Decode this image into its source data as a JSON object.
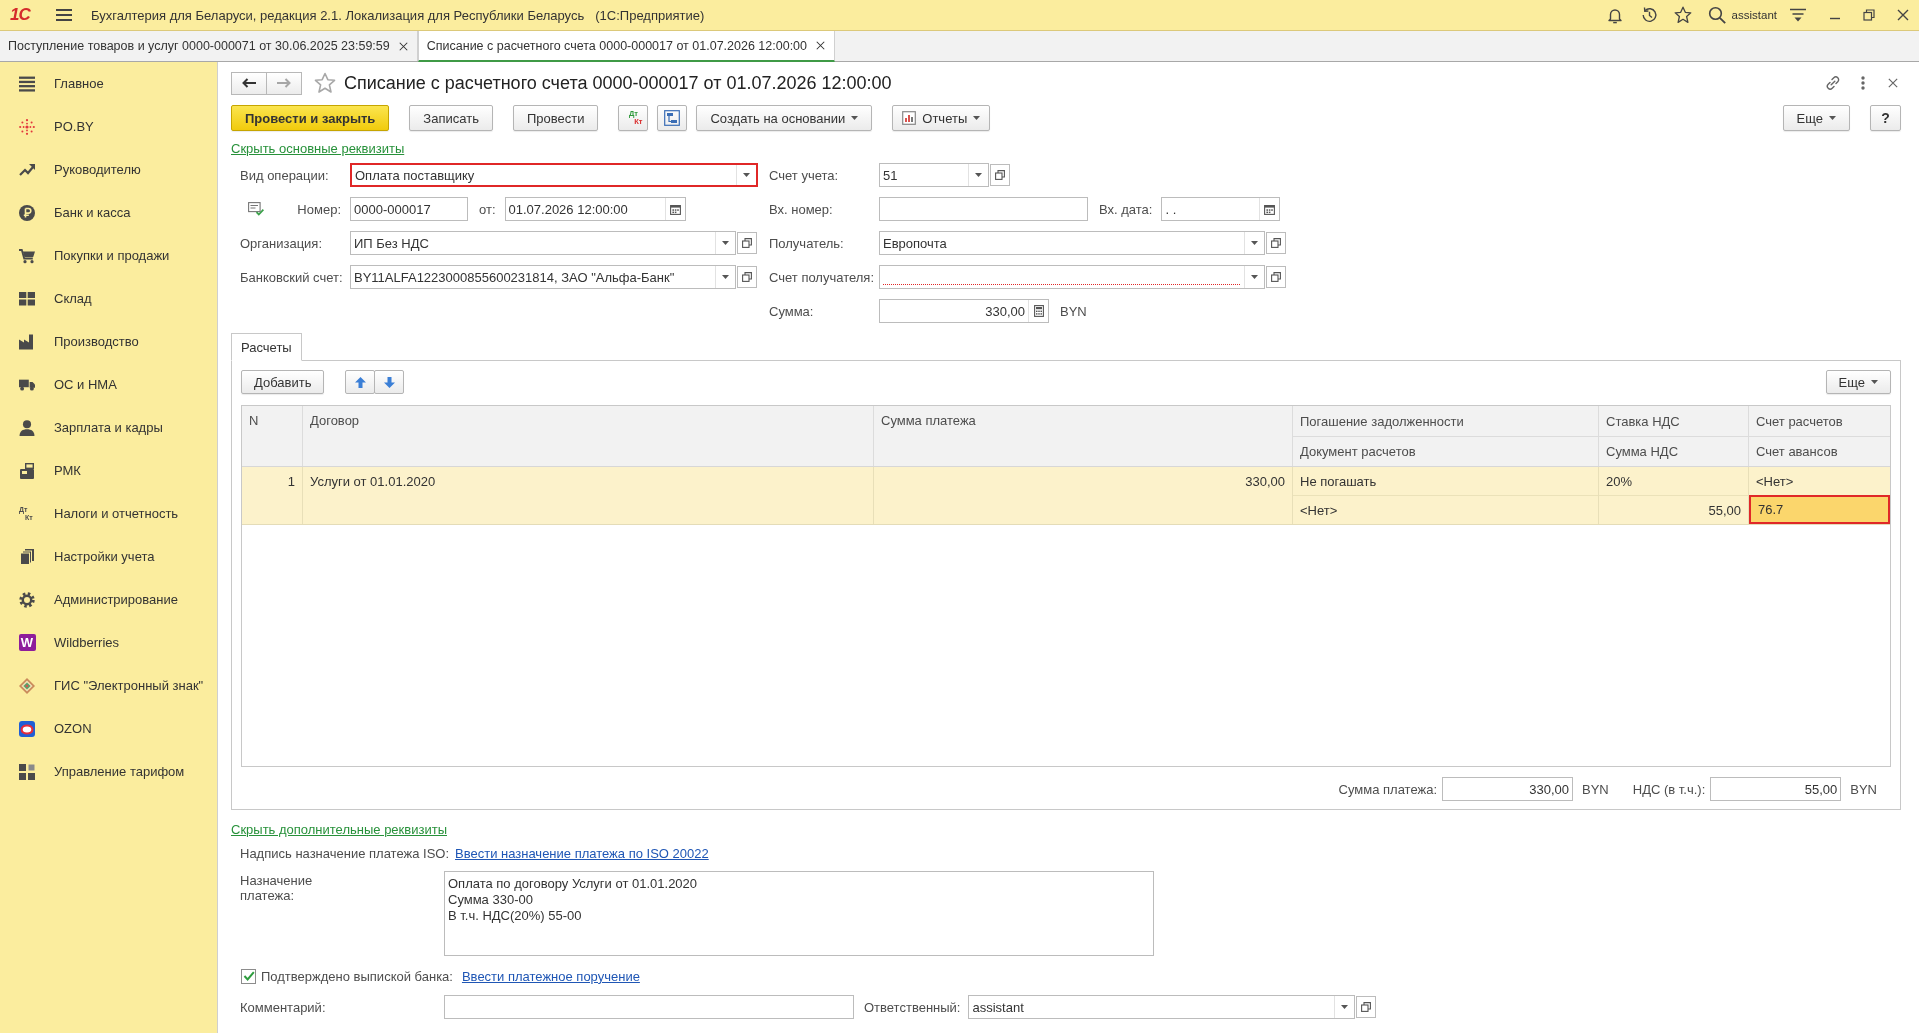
{
  "window": {
    "logo": "1С",
    "title": "Бухгалтерия для Беларуси, редакция 2.1. Локализация для Республики Беларусь",
    "platform": "(1С:Предприятие)",
    "user": "assistant"
  },
  "open_tabs": [
    {
      "label": "Поступление товаров и услуг 0000-000071 от 30.06.2025 23:59:59",
      "selected": false
    },
    {
      "label": "Списание с расчетного счета 0000-000017 от 01.07.2026 12:00:00",
      "selected": true
    }
  ],
  "sidebar": {
    "items": [
      {
        "label": "Главное",
        "selected": false
      },
      {
        "label": "PO.BY",
        "selected": false
      },
      {
        "label": "Руководителю",
        "selected": false
      },
      {
        "label": "Банк и касса",
        "selected": false
      },
      {
        "label": "Покупки и продажи",
        "selected": false
      },
      {
        "label": "Склад",
        "selected": false
      },
      {
        "label": "Производство",
        "selected": false
      },
      {
        "label": "ОС и НМА",
        "selected": false
      },
      {
        "label": "Зарплата и кадры",
        "selected": false
      },
      {
        "label": "РМК",
        "selected": false
      },
      {
        "label": "Налоги и отчетность",
        "selected": false,
        "icon_text": [
          "Дт",
          "Кт"
        ]
      },
      {
        "label": "Настройки учета",
        "selected": false
      },
      {
        "label": "Администрирование",
        "selected": false
      },
      {
        "label": "Wildberries",
        "selected": false,
        "icon_text": [
          "W"
        ]
      },
      {
        "label": "ГИС \"Электронный знак\"",
        "selected": false
      },
      {
        "label": "OZON",
        "selected": false
      },
      {
        "label": "Управление тарифом",
        "selected": false
      }
    ]
  },
  "document": {
    "nav_buttons": [
      {
        "kind": "back",
        "disabled": false
      },
      {
        "kind": "forward",
        "disabled": true
      }
    ],
    "favorite": false,
    "title": "Списание с расчетного счета 0000-000017 от 01.07.2026 12:00:00",
    "toolbar": [
      {
        "kind": "primary",
        "label": "Провести и закрыть"
      },
      {
        "kind": "plain",
        "label": "Записать"
      },
      {
        "kind": "plain",
        "label": "Провести"
      },
      {
        "kind": "dtkt",
        "icon_text": [
          "Дт",
          "Кт"
        ]
      },
      {
        "kind": "icon"
      },
      {
        "kind": "menu",
        "label": "Создать на основании"
      },
      {
        "kind": "menu_icon",
        "label": "Отчеты"
      }
    ],
    "toolbar_right": [
      {
        "kind": "menu",
        "label": "Еще"
      },
      {
        "kind": "help",
        "label": "?"
      }
    ]
  },
  "requisites": {
    "hide_link": "Скрыть основные реквизиты",
    "operation_type": {
      "label": "Вид операции:",
      "value": "Оплата поставщику",
      "highlighted": true
    },
    "number": {
      "label": "Номер:",
      "value": "0000-000017"
    },
    "date": {
      "label": "от:",
      "value": "01.07.2026 12:00:00"
    },
    "organization": {
      "label": "Организация:",
      "value": "ИП Без НДС"
    },
    "bank_account": {
      "label": "Банковский счет:",
      "value": "BY11ALFA1223000855600231814, ЗАО \"Альфа-Банк\""
    },
    "account": {
      "label": "Счет учета:",
      "value": "51"
    },
    "incoming_number": {
      "label": "Вх. номер:"
    },
    "incoming_date": {
      "label": "Вх. дата:",
      "value": ". ."
    },
    "recipient": {
      "label": "Получатель:",
      "value": "Европочта"
    },
    "recipient_account": {
      "label": "Счет получателя:",
      "required": true
    },
    "amount": {
      "label": "Сумма:",
      "value": "330,00",
      "currency": "BYN"
    }
  },
  "detail_tabs": [
    {
      "label": "Расчеты",
      "selected": true
    }
  ],
  "payments": {
    "add_button": "Добавить",
    "more_button": "Еще",
    "table": {
      "columns": [
        {
          "top": "N"
        },
        {
          "top": "Договор"
        },
        {
          "top": "Сумма платежа"
        },
        {
          "top": "Погашение задолженности",
          "bottom": "Документ расчетов"
        },
        {
          "top": "Ставка НДС",
          "bottom": "Сумма НДС"
        },
        {
          "top": "Счет расчетов",
          "bottom": "Счет авансов"
        }
      ],
      "rows": [
        {
          "selected": true,
          "cells": [
            {
              "lines": [
                {
                  "text": "1",
                  "current": false
                }
              ]
            },
            {
              "lines": [
                {
                  "text": "Услуги от 01.01.2020",
                  "current": false
                }
              ]
            },
            {
              "lines": [
                {
                  "text": "330,00",
                  "current": false
                }
              ]
            },
            {
              "lines": [
                {
                  "text": "Не погашать",
                  "current": false
                },
                {
                  "text": "<Нет>",
                  "current": false
                }
              ]
            },
            {
              "lines": [
                {
                  "text": "20%",
                  "current": false
                },
                {
                  "text": "55,00",
                  "current": false
                }
              ]
            },
            {
              "lines": [
                {
                  "text": "<Нет>",
                  "current": false
                },
                {
                  "text": "76.7",
                  "current": true
                }
              ]
            }
          ]
        }
      ]
    },
    "totals": [
      {
        "label": "Сумма платежа:",
        "value": "330,00",
        "currency": "BYN"
      },
      {
        "label": "НДС (в т.ч.):",
        "value": "55,00",
        "currency": "BYN"
      }
    ]
  },
  "additional": {
    "hide_link": "Скрыть дополнительные реквизиты",
    "iso_label": "Надпись назначение платежа ISO:",
    "iso_link": "Ввести назначение платежа по ISO 20022",
    "purpose": {
      "label": "Назначение платежа:",
      "value": "Оплата по договору Услуги от 01.01.2020\nСумма 330-00\nВ т.ч. НДС(20%) 55-00"
    },
    "bank_confirmed": {
      "label": "Подтверждено выпиской банка:",
      "checked": true
    },
    "payment_order_link": "Ввести платежное поручение",
    "comment": {
      "label": "Комментарий:"
    },
    "responsible": {
      "label": "Ответственный:",
      "value": "assistant"
    }
  }
}
